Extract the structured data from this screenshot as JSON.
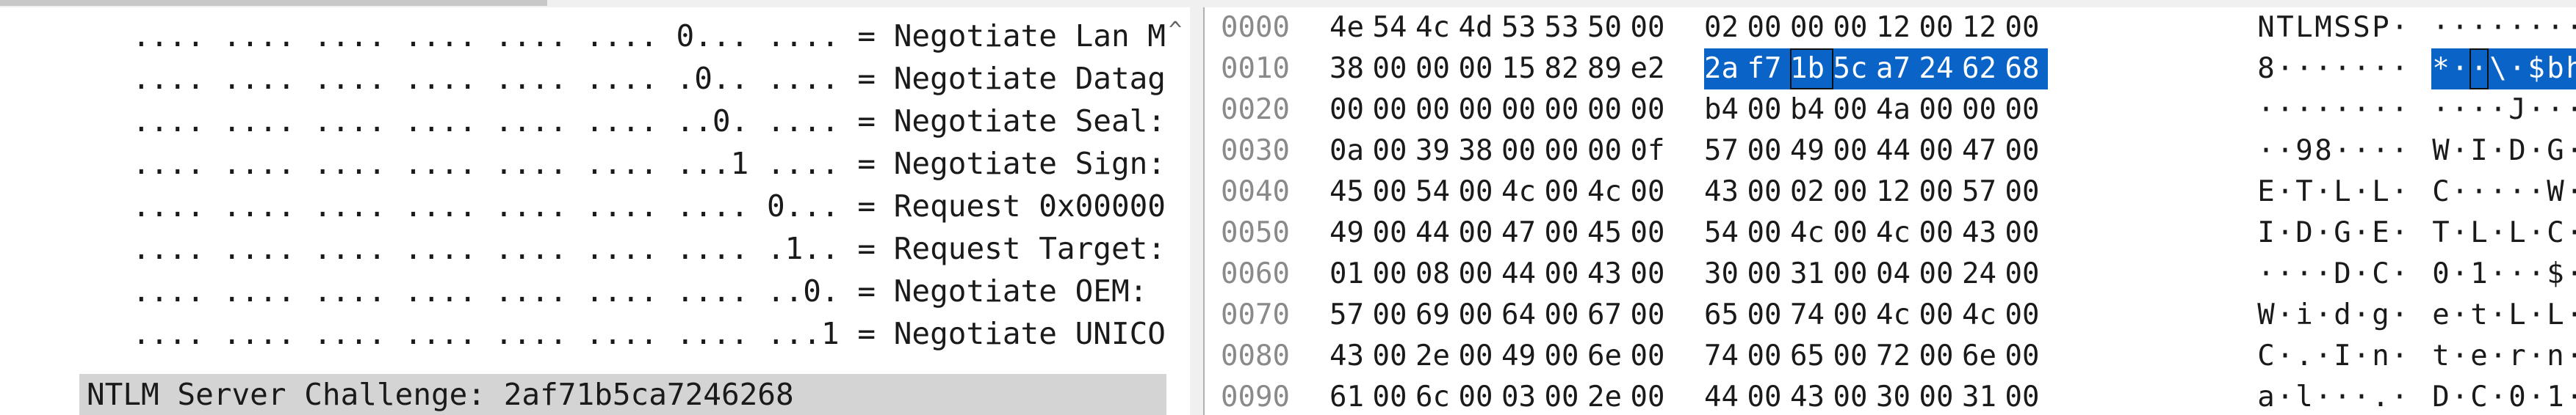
{
  "details": {
    "rows": [
      ".... .... .... .... .... .... 0... .... = Negotiate Lan M",
      ".... .... .... .... .... .... .0.. .... = Negotiate Datag",
      ".... .... .... .... .... .... ..0. .... = Negotiate Seal:",
      ".... .... .... .... .... .... ...1 .... = Negotiate Sign:",
      ".... .... .... .... .... .... .... 0... = Request 0x00000",
      ".... .... .... .... .... .... .... .1.. = Request Target:",
      ".... .... .... .... .... .... .... ..0. = Negotiate OEM: ",
      ".... .... .... .... .... .... .... ...1 = Negotiate UNICO"
    ],
    "selected_row": "NTLM Server Challenge: 2af71b5ca7246268",
    "scroll_up_glyph": "^"
  },
  "hex": {
    "rows": [
      {
        "offset": "0000",
        "bytes": [
          "4e",
          "54",
          "4c",
          "4d",
          "53",
          "53",
          "50",
          "00",
          "02",
          "00",
          "00",
          "00",
          "12",
          "00",
          "12",
          "00"
        ],
        "ascii": [
          "N",
          "T",
          "L",
          "M",
          "S",
          "S",
          "P",
          "·",
          "·",
          "·",
          "·",
          "·",
          "·",
          "·",
          "·",
          "·"
        ]
      },
      {
        "offset": "0010",
        "bytes": [
          "38",
          "00",
          "00",
          "00",
          "15",
          "82",
          "89",
          "e2",
          "2a",
          "f7",
          "1b",
          "5c",
          "a7",
          "24",
          "62",
          "68"
        ],
        "ascii": [
          "8",
          "·",
          "·",
          "·",
          "·",
          "·",
          "·",
          "·",
          "*",
          "·",
          "·",
          "\\",
          "·",
          "$",
          "b",
          "h"
        ]
      },
      {
        "offset": "0020",
        "bytes": [
          "00",
          "00",
          "00",
          "00",
          "00",
          "00",
          "00",
          "00",
          "b4",
          "00",
          "b4",
          "00",
          "4a",
          "00",
          "00",
          "00"
        ],
        "ascii": [
          "·",
          "·",
          "·",
          "·",
          "·",
          "·",
          "·",
          "·",
          "·",
          "·",
          "·",
          "·",
          "J",
          "·",
          "·",
          "·"
        ]
      },
      {
        "offset": "0030",
        "bytes": [
          "0a",
          "00",
          "39",
          "38",
          "00",
          "00",
          "00",
          "0f",
          "57",
          "00",
          "49",
          "00",
          "44",
          "00",
          "47",
          "00"
        ],
        "ascii": [
          "·",
          "·",
          "9",
          "8",
          "·",
          "·",
          "·",
          "·",
          "W",
          "·",
          "I",
          "·",
          "D",
          "·",
          "G",
          "·"
        ]
      },
      {
        "offset": "0040",
        "bytes": [
          "45",
          "00",
          "54",
          "00",
          "4c",
          "00",
          "4c",
          "00",
          "43",
          "00",
          "02",
          "00",
          "12",
          "00",
          "57",
          "00"
        ],
        "ascii": [
          "E",
          "·",
          "T",
          "·",
          "L",
          "·",
          "L",
          "·",
          "C",
          "·",
          "·",
          "·",
          "·",
          "·",
          "W",
          "·"
        ]
      },
      {
        "offset": "0050",
        "bytes": [
          "49",
          "00",
          "44",
          "00",
          "47",
          "00",
          "45",
          "00",
          "54",
          "00",
          "4c",
          "00",
          "4c",
          "00",
          "43",
          "00"
        ],
        "ascii": [
          "I",
          "·",
          "D",
          "·",
          "G",
          "·",
          "E",
          "·",
          "T",
          "·",
          "L",
          "·",
          "L",
          "·",
          "C",
          "·"
        ]
      },
      {
        "offset": "0060",
        "bytes": [
          "01",
          "00",
          "08",
          "00",
          "44",
          "00",
          "43",
          "00",
          "30",
          "00",
          "31",
          "00",
          "04",
          "00",
          "24",
          "00"
        ],
        "ascii": [
          "·",
          "·",
          "·",
          "·",
          "D",
          "·",
          "C",
          "·",
          "0",
          "·",
          "1",
          "·",
          "·",
          "·",
          "$",
          "·"
        ]
      },
      {
        "offset": "0070",
        "bytes": [
          "57",
          "00",
          "69",
          "00",
          "64",
          "00",
          "67",
          "00",
          "65",
          "00",
          "74",
          "00",
          "4c",
          "00",
          "4c",
          "00"
        ],
        "ascii": [
          "W",
          "·",
          "i",
          "·",
          "d",
          "·",
          "g",
          "·",
          "e",
          "·",
          "t",
          "·",
          "L",
          "·",
          "L",
          "·"
        ]
      },
      {
        "offset": "0080",
        "bytes": [
          "43",
          "00",
          "2e",
          "00",
          "49",
          "00",
          "6e",
          "00",
          "74",
          "00",
          "65",
          "00",
          "72",
          "00",
          "6e",
          "00"
        ],
        "ascii": [
          "C",
          "·",
          ".",
          "·",
          "I",
          "·",
          "n",
          "·",
          "t",
          "·",
          "e",
          "·",
          "r",
          "·",
          "n",
          "·"
        ]
      },
      {
        "offset": "0090",
        "bytes": [
          "61",
          "00",
          "6c",
          "00",
          "03",
          "00",
          "2e",
          "00",
          "44",
          "00",
          "43",
          "00",
          "30",
          "00",
          "31",
          "00"
        ],
        "ascii": [
          "a",
          "·",
          "l",
          "·",
          "·",
          "·",
          ".",
          "·",
          "D",
          "·",
          "C",
          "·",
          "0",
          "·",
          "1",
          "·"
        ]
      }
    ],
    "selection": {
      "row": 1,
      "start": 8,
      "end": 15,
      "cursor": 10
    }
  }
}
